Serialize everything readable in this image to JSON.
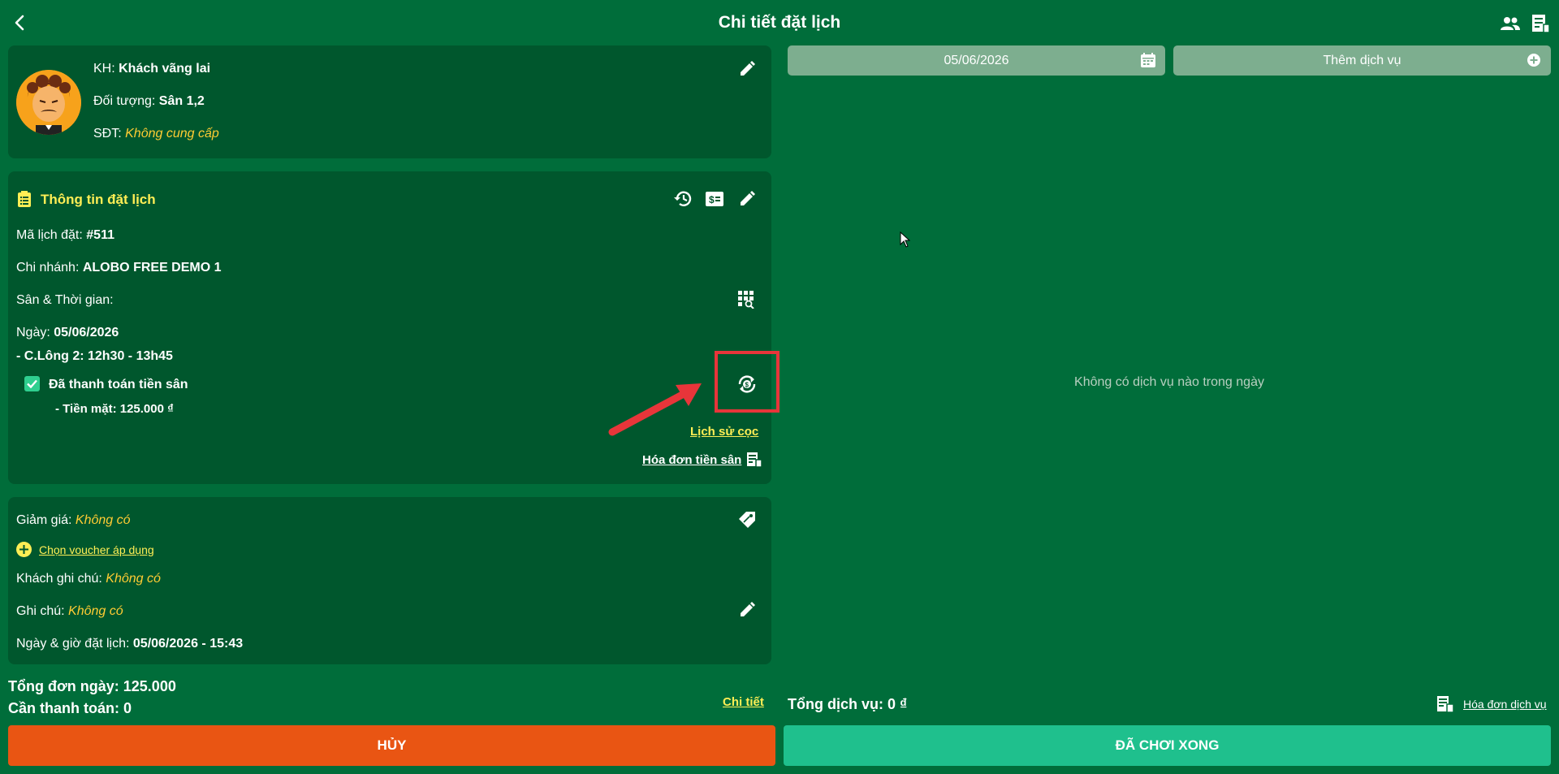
{
  "header": {
    "title": "Chi tiết đặt lịch"
  },
  "customer": {
    "name_label": "KH: ",
    "name": "Khách vãng lai",
    "target_label": "Đối tượng: ",
    "target": "Sân 1,2",
    "phone_label": "SĐT: ",
    "phone": "Không cung cấp"
  },
  "booking": {
    "section_title": "Thông tin đặt lịch",
    "code_label": "Mã lịch đặt: ",
    "code": "#511",
    "branch_label": "Chi nhánh: ",
    "branch": "ALOBO FREE DEMO 1",
    "court_time_label": "Sân & Thời gian:",
    "date_label": "Ngày: ",
    "date": "05/06/2026",
    "slot": " - C.Lông 2: 12h30 - 13h45",
    "paid_label": "Đã thanh toán tiền sân",
    "cash_line": "- Tiền mặt: 125.000 ₫",
    "deposit_history": "Lịch sử cọc",
    "court_invoice": "Hóa đơn tiền sân"
  },
  "extras": {
    "discount_label": "Giảm giá: ",
    "discount": "Không có",
    "voucher_link": "Chọn voucher áp dụng",
    "customer_note_label": "Khách ghi chú: ",
    "customer_note": "Không có",
    "note_label": "Ghi chú: ",
    "note": "Không có",
    "booked_at_label": "Ngày & giờ đặt lịch: ",
    "booked_at": "05/06/2026 - 15:43"
  },
  "summary": {
    "day_total": "Tổng đơn ngày: 125.000",
    "to_pay": "Cần thanh toán: 0",
    "detail_link": "Chi tiết"
  },
  "services": {
    "date": "05/06/2026",
    "add_service": "Thêm dịch vụ",
    "empty": "Không có dịch vụ nào trong ngày",
    "total": "Tổng dịch vụ: 0 ₫",
    "invoice_link": "Hóa đơn dịch vụ"
  },
  "actions": {
    "cancel": "HỦY",
    "done": "ĐÃ CHƠI XONG"
  },
  "colors": {
    "background": "#006d3a",
    "card": "#00572d",
    "accent_yellow": "#ffee55",
    "italic_yellow": "#ffcc33",
    "cancel": "#e95513",
    "done": "#1fc08d",
    "highlight": "#e8353a"
  }
}
